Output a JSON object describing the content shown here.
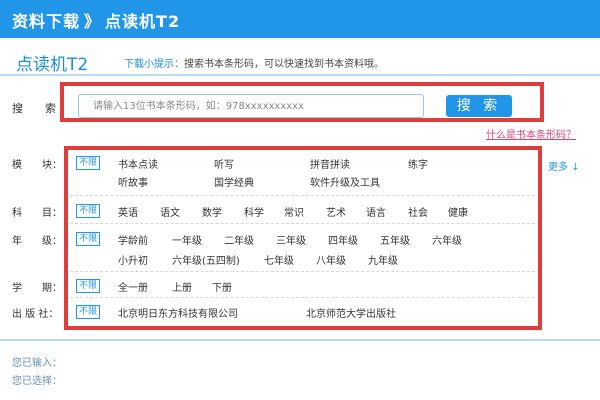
{
  "header": {
    "crumb_root": "资料下载",
    "separator": "》",
    "crumb_current": "点读机T2"
  },
  "page_title": "点读机T2",
  "tip": {
    "label": "下载小提示：",
    "text": "搜索书本条形码，可以快速找到书本资料哦。"
  },
  "search": {
    "label": "搜索",
    "placeholder": "请输入13位书本条形码，如：978xxxxxxxxxx",
    "button": "搜 索",
    "help_link": "什么是书本条形码？"
  },
  "filters": {
    "all_label": "不限",
    "more_label": "更多 ↓",
    "module": {
      "label": "模　　块：",
      "options": [
        "书本点读",
        "听写",
        "拼音拼读",
        "练字",
        "听故事",
        "国学经典",
        "软件升级及工具"
      ]
    },
    "subject": {
      "label": "科　　目：",
      "options": [
        "英语",
        "语文",
        "数学",
        "科学",
        "常识",
        "艺术",
        "语言",
        "社会",
        "健康"
      ]
    },
    "grade": {
      "label": "年　　级：",
      "options": [
        "学龄前",
        "一年级",
        "二年级",
        "三年级",
        "四年级",
        "五年级",
        "六年级",
        "小升初",
        "六年级(五四制)",
        "七年级",
        "八年级",
        "九年级"
      ]
    },
    "term": {
      "label": "学　　期：",
      "options": [
        "全一册",
        "上册",
        "下册"
      ]
    },
    "publisher": {
      "label": "出 版 社：",
      "options": [
        "北京明日东方科技有限公司",
        "北京师范大学出版社"
      ]
    }
  },
  "footer": {
    "entered": "您已输入：",
    "selected": "您已选择："
  },
  "colors": {
    "brand": "#2196e8",
    "highlight": "#e03c3c"
  }
}
